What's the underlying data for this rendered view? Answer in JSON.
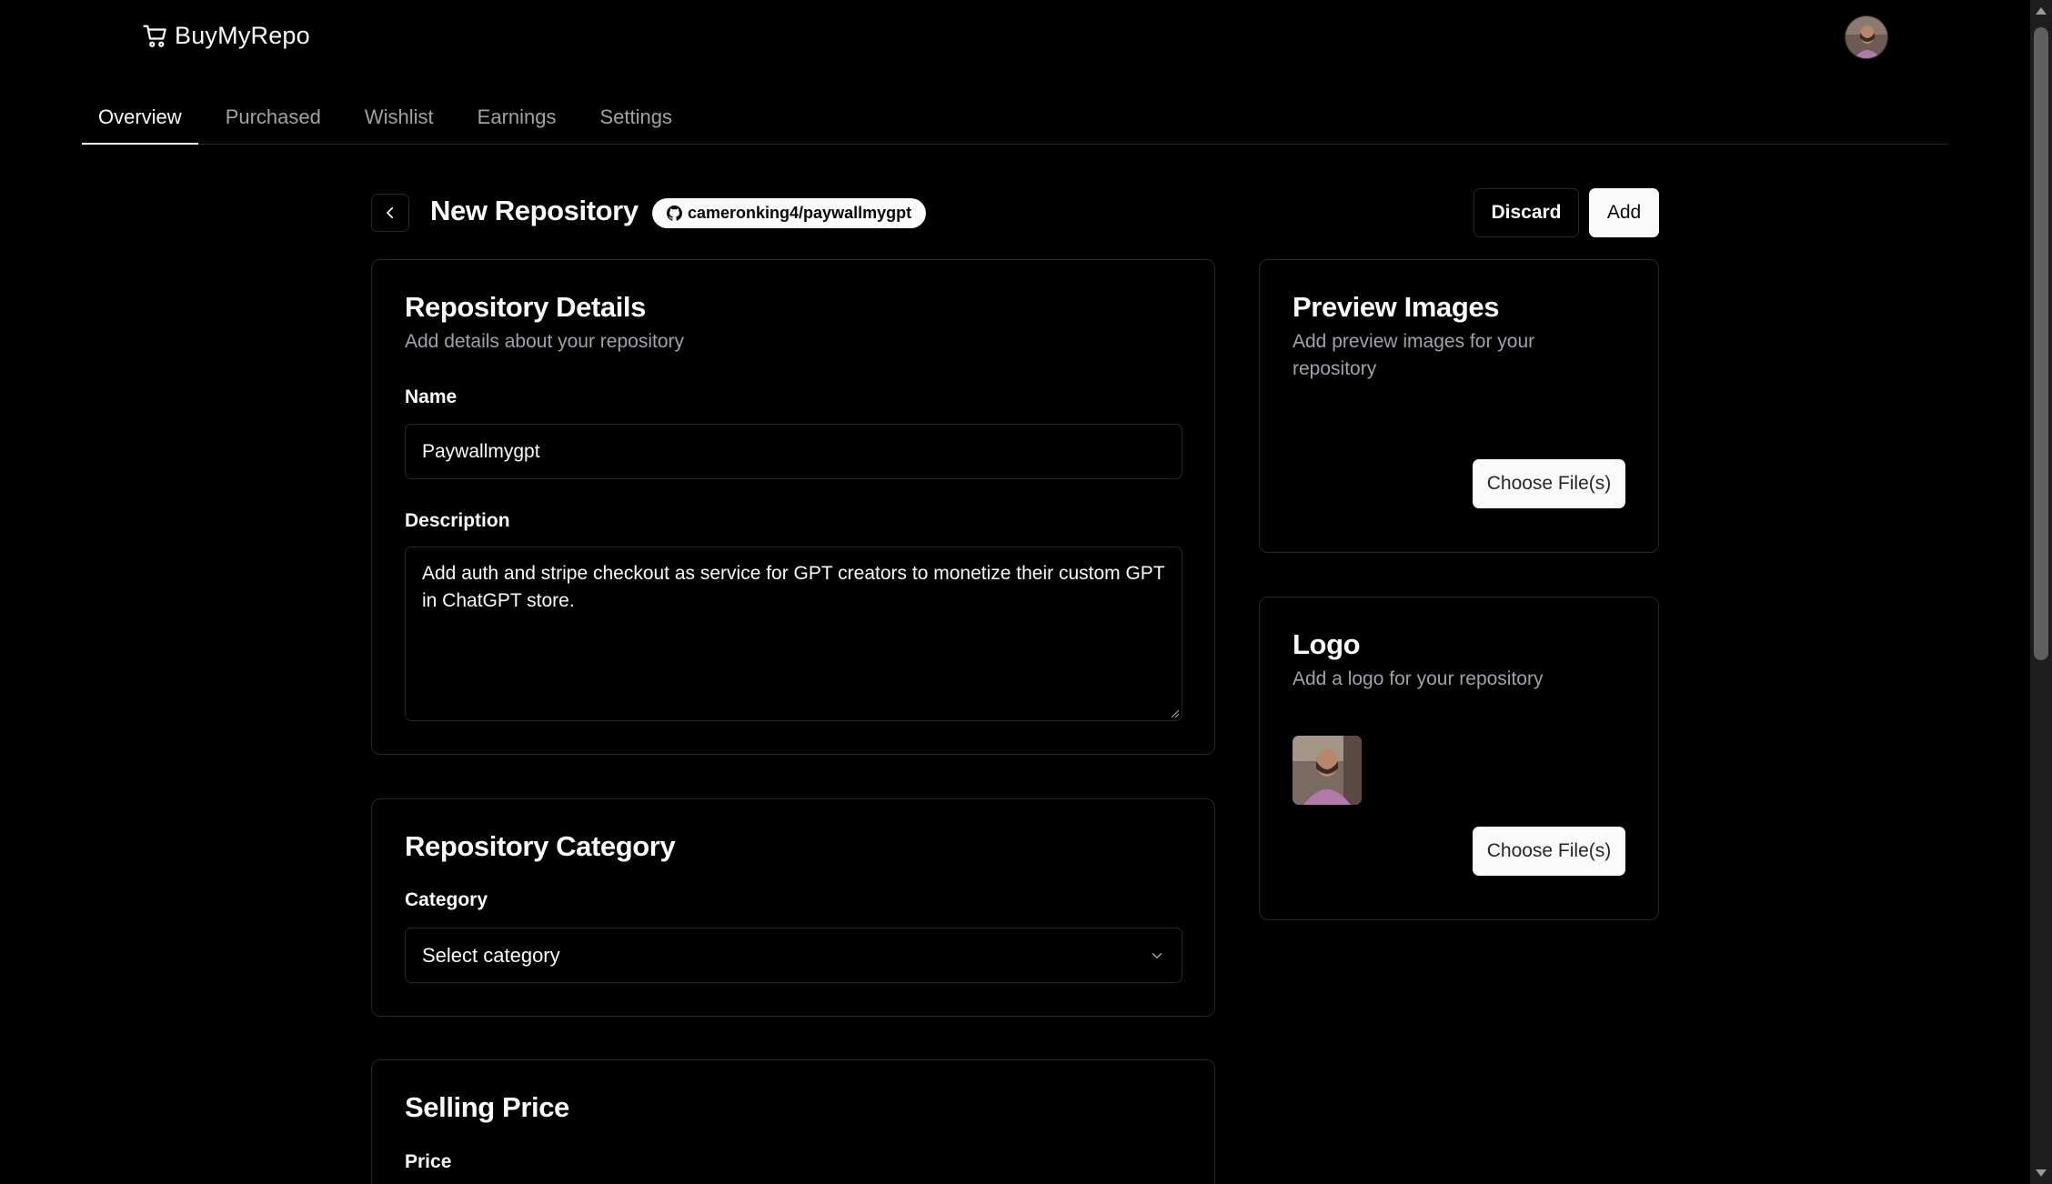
{
  "app": {
    "name": "BuyMyRepo",
    "logo_icon": "cart-icon"
  },
  "tabs": [
    {
      "label": "Overview",
      "active": true
    },
    {
      "label": "Purchased",
      "active": false
    },
    {
      "label": "Wishlist",
      "active": false
    },
    {
      "label": "Earnings",
      "active": false
    },
    {
      "label": "Settings",
      "active": false
    }
  ],
  "header": {
    "title": "New Repository",
    "repo": "cameronking4/paywallmygpt",
    "discard_label": "Discard",
    "add_label": "Add"
  },
  "details": {
    "title": "Repository Details",
    "description": "Add details about your repository",
    "name_label": "Name",
    "name_value": "Paywallmygpt",
    "description_label": "Description",
    "description_value": "Add auth and stripe checkout as service for GPT creators to monetize their custom GPT in ChatGPT store."
  },
  "category": {
    "title": "Repository Category",
    "label": "Category",
    "placeholder": "Select category"
  },
  "price": {
    "title": "Selling Price",
    "label": "Price"
  },
  "preview": {
    "title": "Preview Images",
    "description": "Add preview images for your repository",
    "button": "Choose File(s)"
  },
  "logo": {
    "title": "Logo",
    "description": "Add a logo for your repository",
    "button": "Choose File(s)"
  },
  "colors": {
    "background": "#000000",
    "foreground": "#fafafa",
    "muted": "#a1a1aa",
    "border": "#27272a"
  }
}
